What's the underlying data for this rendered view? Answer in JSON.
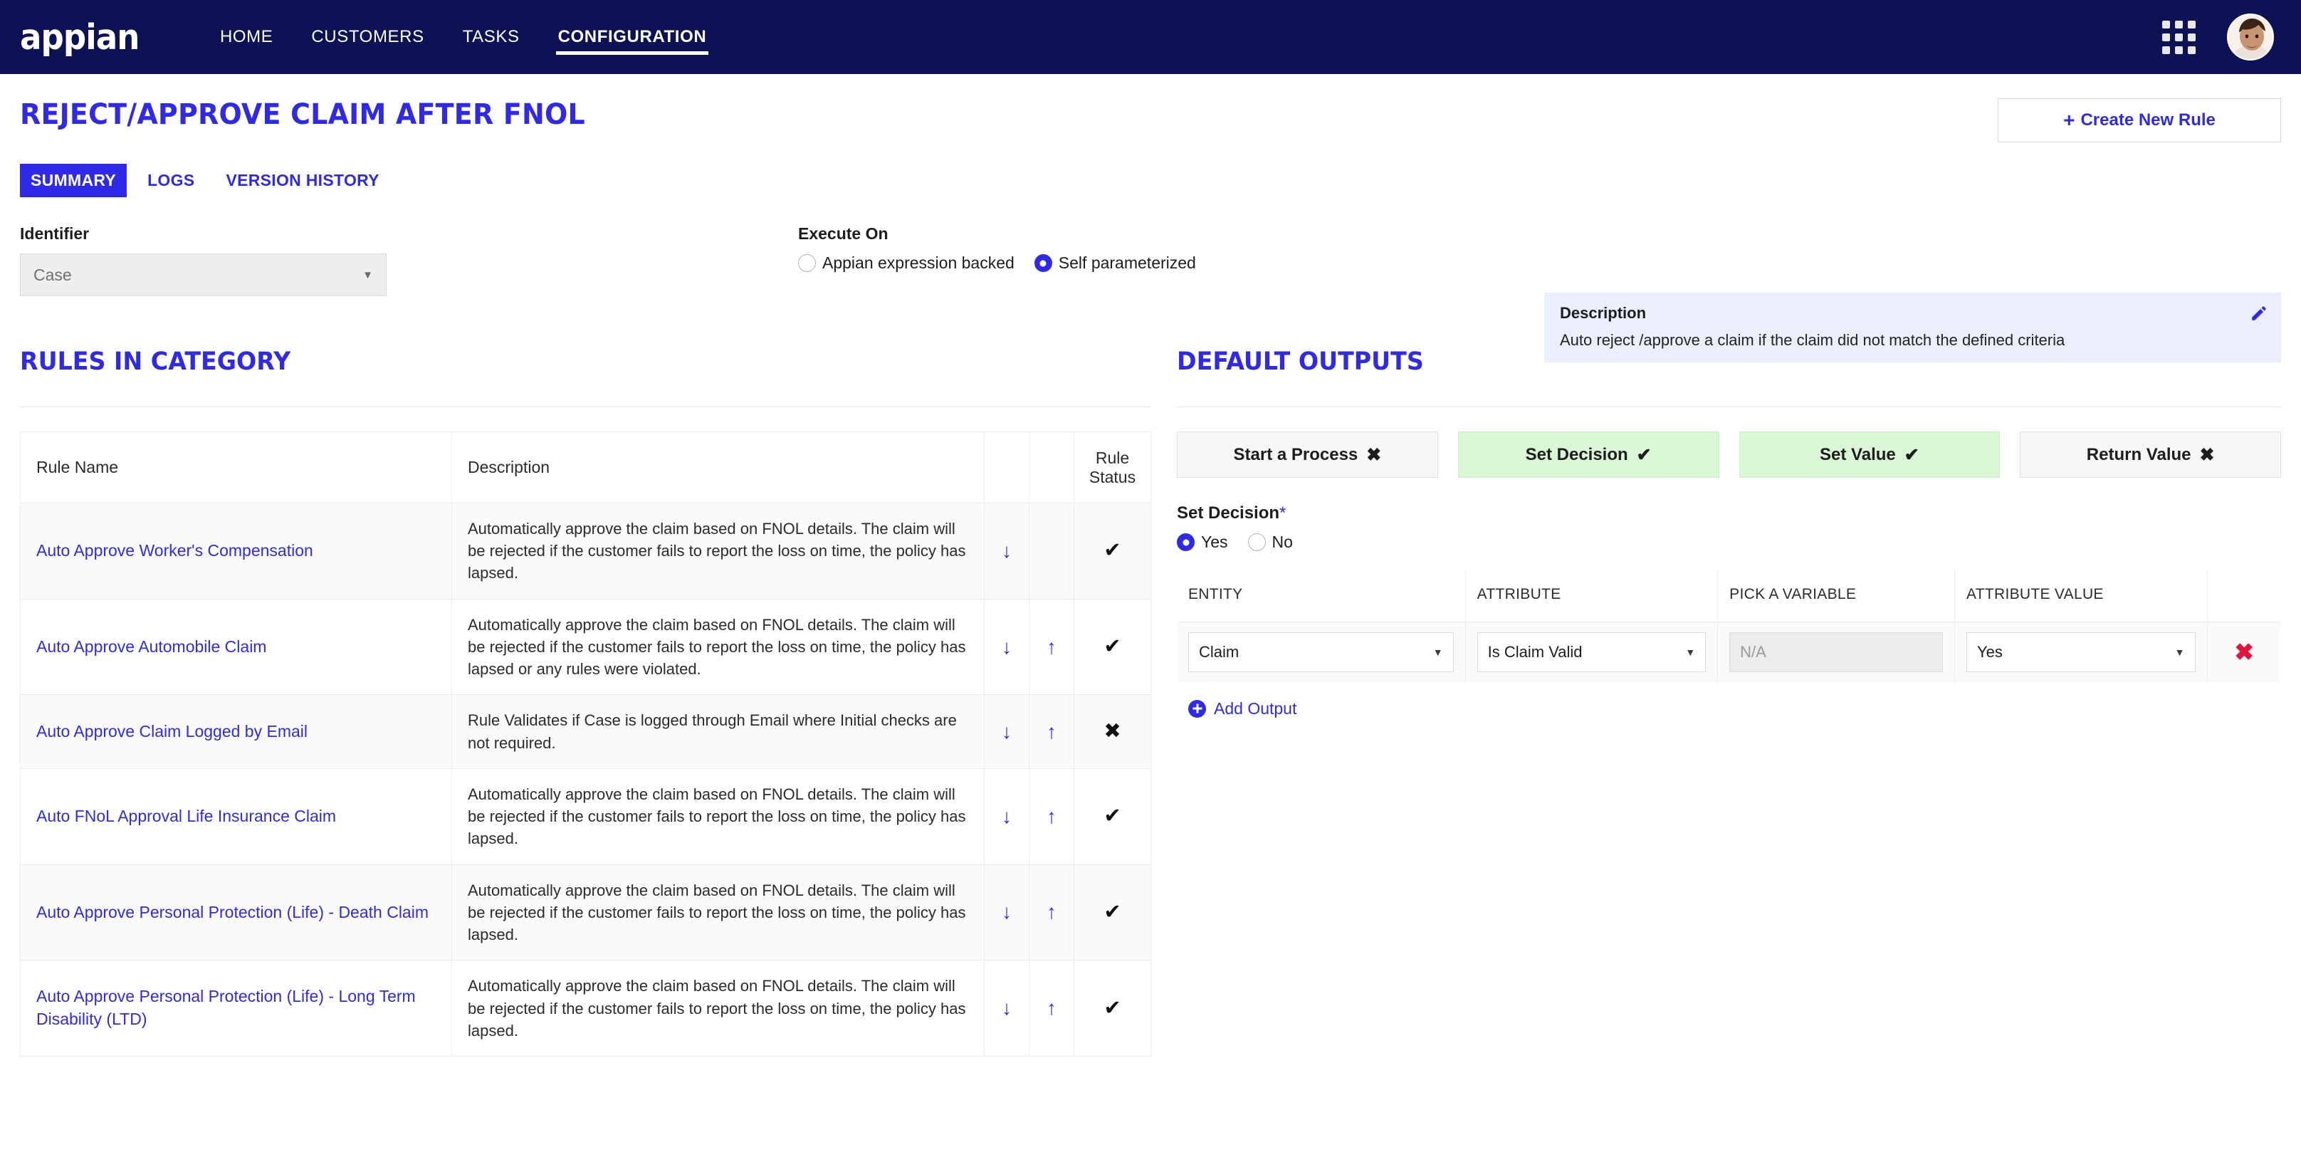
{
  "brand": {
    "logo_text": "appian",
    "accent": "#2f2ae8",
    "navy": "#0d1255"
  },
  "nav": {
    "items": [
      {
        "label": "HOME",
        "active": false
      },
      {
        "label": "CUSTOMERS",
        "active": false
      },
      {
        "label": "TASKS",
        "active": false
      },
      {
        "label": "CONFIGURATION",
        "active": true
      }
    ],
    "apps_icon": "grid-apps-icon",
    "avatar_icon": "user-avatar"
  },
  "header": {
    "page_title": "REJECT/APPROVE CLAIM AFTER FNOL",
    "create_button": "Create New Rule",
    "create_button_icon": "plus-icon"
  },
  "tabs": [
    {
      "label": "SUMMARY",
      "active": true
    },
    {
      "label": "LOGS",
      "active": false
    },
    {
      "label": "VERSION HISTORY",
      "active": false
    }
  ],
  "identifier": {
    "label": "Identifier",
    "value": "Case",
    "caret_icon": "chevron-down-icon"
  },
  "execute_on": {
    "label": "Execute On",
    "options": [
      {
        "label": "Appian expression backed",
        "selected": false
      },
      {
        "label": "Self parameterized",
        "selected": true
      }
    ]
  },
  "description": {
    "label": "Description",
    "text": "Auto reject /approve a claim if the claim did not match the defined criteria",
    "edit_icon": "pencil-icon"
  },
  "rules_section": {
    "title": "RULES IN CATEGORY",
    "columns": [
      "Rule Name",
      "Description",
      "",
      "",
      "Rule Status"
    ],
    "rows": [
      {
        "name": "Auto Approve Worker's Compensation",
        "description": "Automatically approve the claim based on FNOL details. The claim will be rejected if the customer fails to report the loss on time, the policy has lapsed.",
        "move_down": "↓",
        "move_up": "",
        "status": "✔"
      },
      {
        "name": "Auto Approve Automobile Claim",
        "description": "Automatically approve the claim based on FNOL details. The claim will be rejected if the customer fails to report the loss on time, the policy has lapsed or any rules were violated.",
        "move_down": "↓",
        "move_up": "↑",
        "status": "✔"
      },
      {
        "name": "Auto Approve Claim Logged by Email",
        "description": "Rule Validates if Case is logged through Email where Initial checks are not required.",
        "move_down": "↓",
        "move_up": "↑",
        "status": "✖"
      },
      {
        "name": "Auto FNoL Approval Life Insurance Claim",
        "description": "Automatically approve the claim based on FNOL details. The claim will be rejected if the customer fails to report the loss on time, the policy has lapsed.",
        "move_down": "↓",
        "move_up": "↑",
        "status": "✔"
      },
      {
        "name": "Auto Approve Personal Protection (Life) - Death Claim",
        "description": "Automatically approve the claim based on FNOL details. The claim will be rejected if the customer fails to report the loss on time, the policy has lapsed.",
        "move_down": "↓",
        "move_up": "↑",
        "status": "✔"
      },
      {
        "name": "Auto Approve Personal Protection (Life) - Long Term Disability (LTD)",
        "description": "Automatically approve the claim based on FNOL details. The claim will be rejected if the customer fails to report the loss on time, the policy has lapsed.",
        "move_down": "↓",
        "move_up": "↑",
        "status": "✔"
      }
    ]
  },
  "outputs_section": {
    "title": "DEFAULT OUTPUTS",
    "type_buttons": [
      {
        "label": "Start a Process",
        "mark": "✖",
        "enabled": false
      },
      {
        "label": "Set Decision",
        "mark": "✔",
        "enabled": true
      },
      {
        "label": "Set Value",
        "mark": "✔",
        "enabled": true
      },
      {
        "label": "Return Value",
        "mark": "✖",
        "enabled": false
      }
    ],
    "set_decision": {
      "label": "Set Decision",
      "required_mark": "*",
      "options": [
        {
          "label": "Yes",
          "selected": true
        },
        {
          "label": "No",
          "selected": false
        }
      ]
    },
    "table": {
      "columns": [
        "ENTITY",
        "ATTRIBUTE",
        "PICK A VARIABLE",
        "ATTRIBUTE VALUE"
      ],
      "rows": [
        {
          "entity": "Claim",
          "attribute": "Is Claim Valid",
          "variable": "N/A",
          "variable_disabled": true,
          "attribute_value": "Yes",
          "delete_icon": "✖"
        }
      ]
    },
    "add_output": {
      "label": "Add Output",
      "icon": "plus-circle-icon"
    }
  }
}
